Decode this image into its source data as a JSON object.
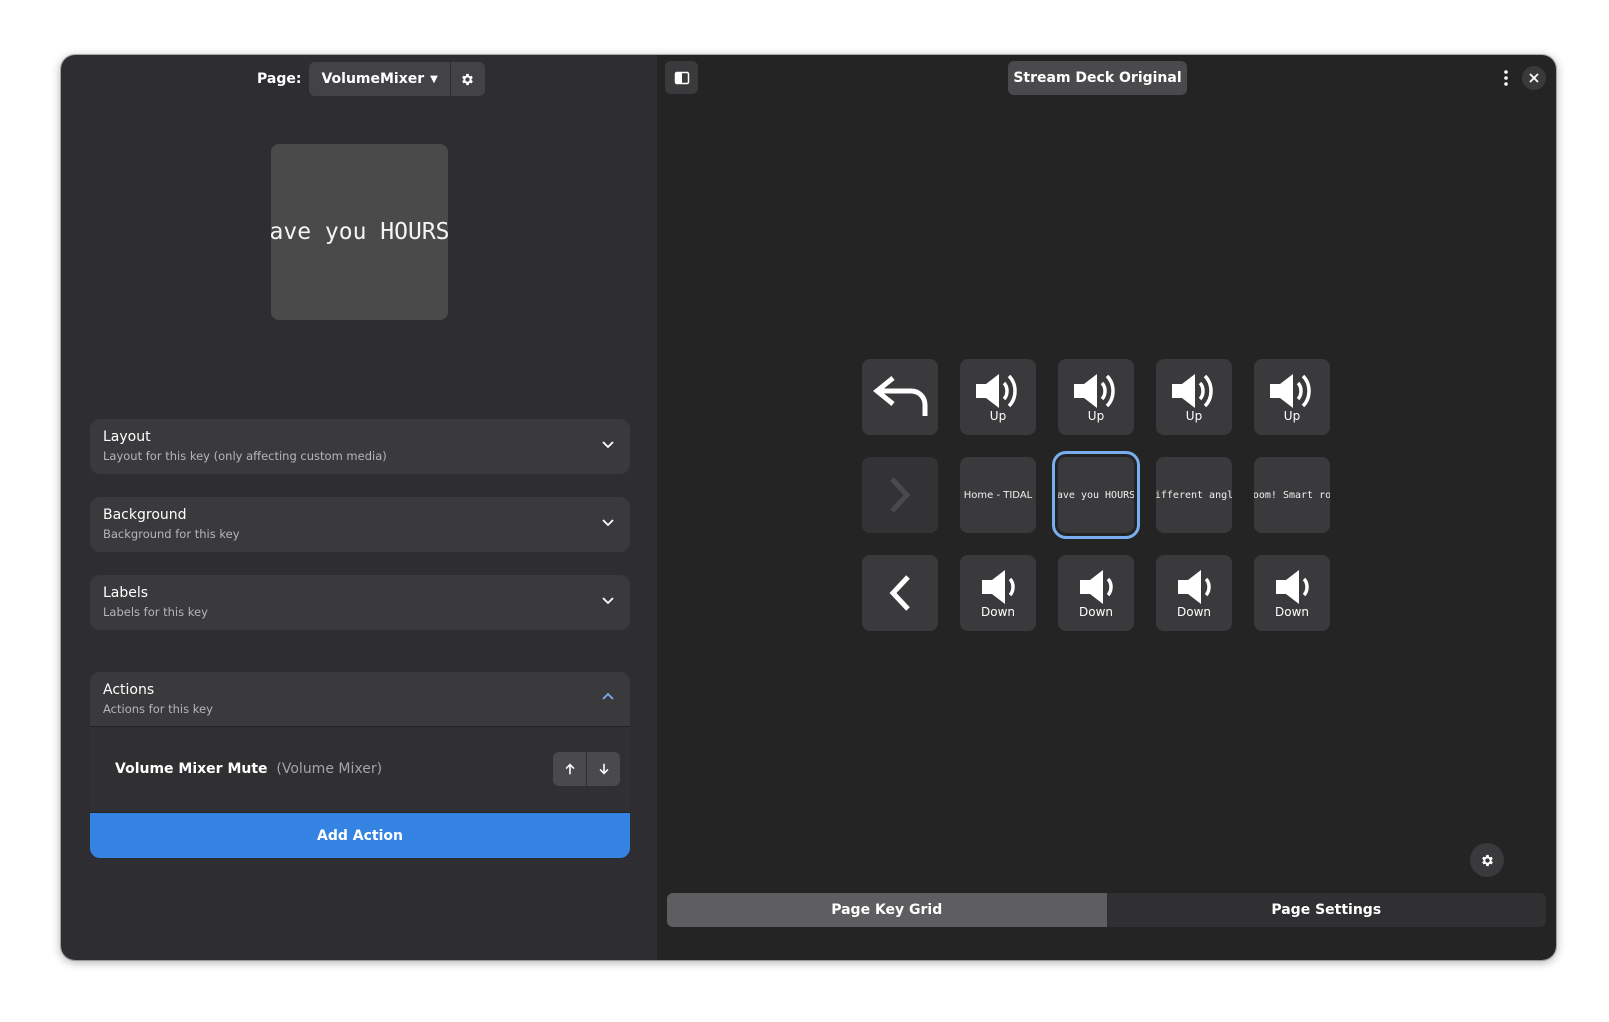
{
  "page_selector": {
    "label": "Page:",
    "current_page": "VolumeMixer"
  },
  "key_preview": {
    "text": "ave you HOURS"
  },
  "config_rows": [
    {
      "title": "Layout",
      "subtitle": "Layout for this key (only affecting custom media)"
    },
    {
      "title": "Background",
      "subtitle": "Background for this key"
    },
    {
      "title": "Labels",
      "subtitle": "Labels for this key"
    }
  ],
  "actions": {
    "title": "Actions",
    "subtitle": "Actions for this key",
    "items": [
      {
        "name": "Volume Mixer Mute",
        "category": "(Volume Mixer)"
      }
    ],
    "add_label": "Add Action"
  },
  "deck": {
    "name": "Stream Deck Original"
  },
  "keys": {
    "row1": [
      "",
      "Up",
      "Up",
      "Up",
      "Up"
    ],
    "row2": [
      "",
      "Home - TIDAL",
      "ave you HOURS",
      "different angle",
      "oom! Smart ro"
    ],
    "row3": [
      "",
      "Down",
      "Down",
      "Down",
      "Down"
    ]
  },
  "tabs": {
    "key_grid": "Page Key Grid",
    "settings": "Page Settings"
  },
  "colors": {
    "accent": "#3584e4",
    "selection": "#78aeed",
    "sidebar_bg": "#2e2e32",
    "main_bg": "#242424"
  }
}
